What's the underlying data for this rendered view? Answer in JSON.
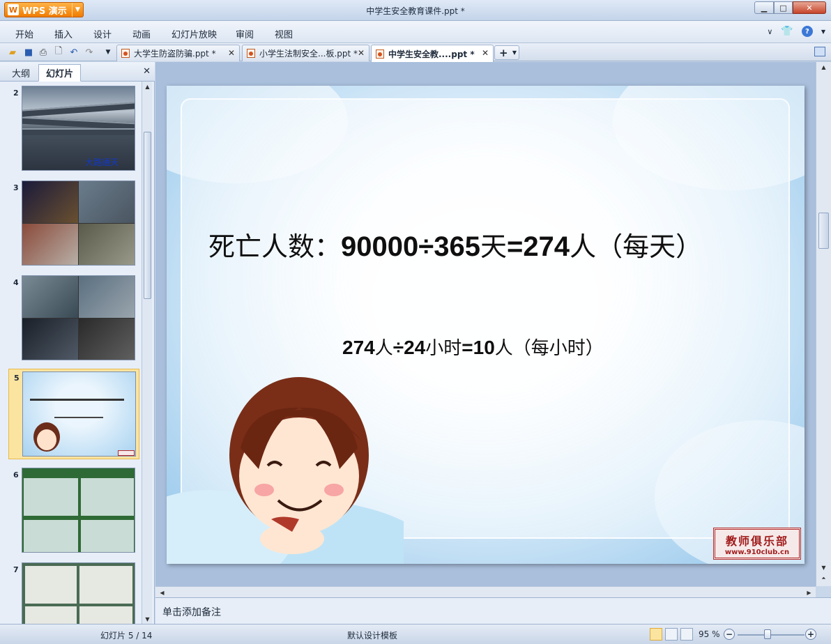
{
  "app": {
    "menu_label": "WPS 演示",
    "logo_glyph": "W",
    "window_title": "中学生安全教育课件.ppt *",
    "brand_color": "#f07c00"
  },
  "menubar": {
    "items": [
      "开始",
      "插入",
      "设计",
      "动画",
      "幻灯片放映",
      "审阅",
      "视图"
    ]
  },
  "doc_tabs": [
    {
      "label": "大学生防盗防骗.ppt *",
      "active": false
    },
    {
      "label": "小学生法制安全...板.ppt *",
      "active": false
    },
    {
      "label": "中学生安全教....ppt *",
      "active": true
    }
  ],
  "left_panel": {
    "tabs": [
      "大纲",
      "幻灯片"
    ],
    "active_tab": "幻灯片",
    "slides": [
      {
        "number": "2",
        "caption": "大路通天"
      },
      {
        "number": "3"
      },
      {
        "number": "4"
      },
      {
        "number": "5",
        "selected": true
      },
      {
        "number": "6"
      },
      {
        "number": "7"
      }
    ]
  },
  "slide": {
    "line1_prefix": "死亡人数：",
    "line1_a": "90000÷365",
    "line1_b": "天",
    "line1_c": "=274",
    "line1_d": "人（每天）",
    "line2_a": "274",
    "line2_b": "人",
    "line2_c": "÷24",
    "line2_d": "小时",
    "line2_e": "=10",
    "line2_f": "人（每小时）",
    "stamp_title": "教师俱乐部",
    "stamp_url": "www.910club.cn"
  },
  "notes": {
    "placeholder": "单击添加备注"
  },
  "statusbar": {
    "slide_position": "幻灯片 5 / 14",
    "template": "默认设计模板",
    "zoom": "95 %"
  }
}
